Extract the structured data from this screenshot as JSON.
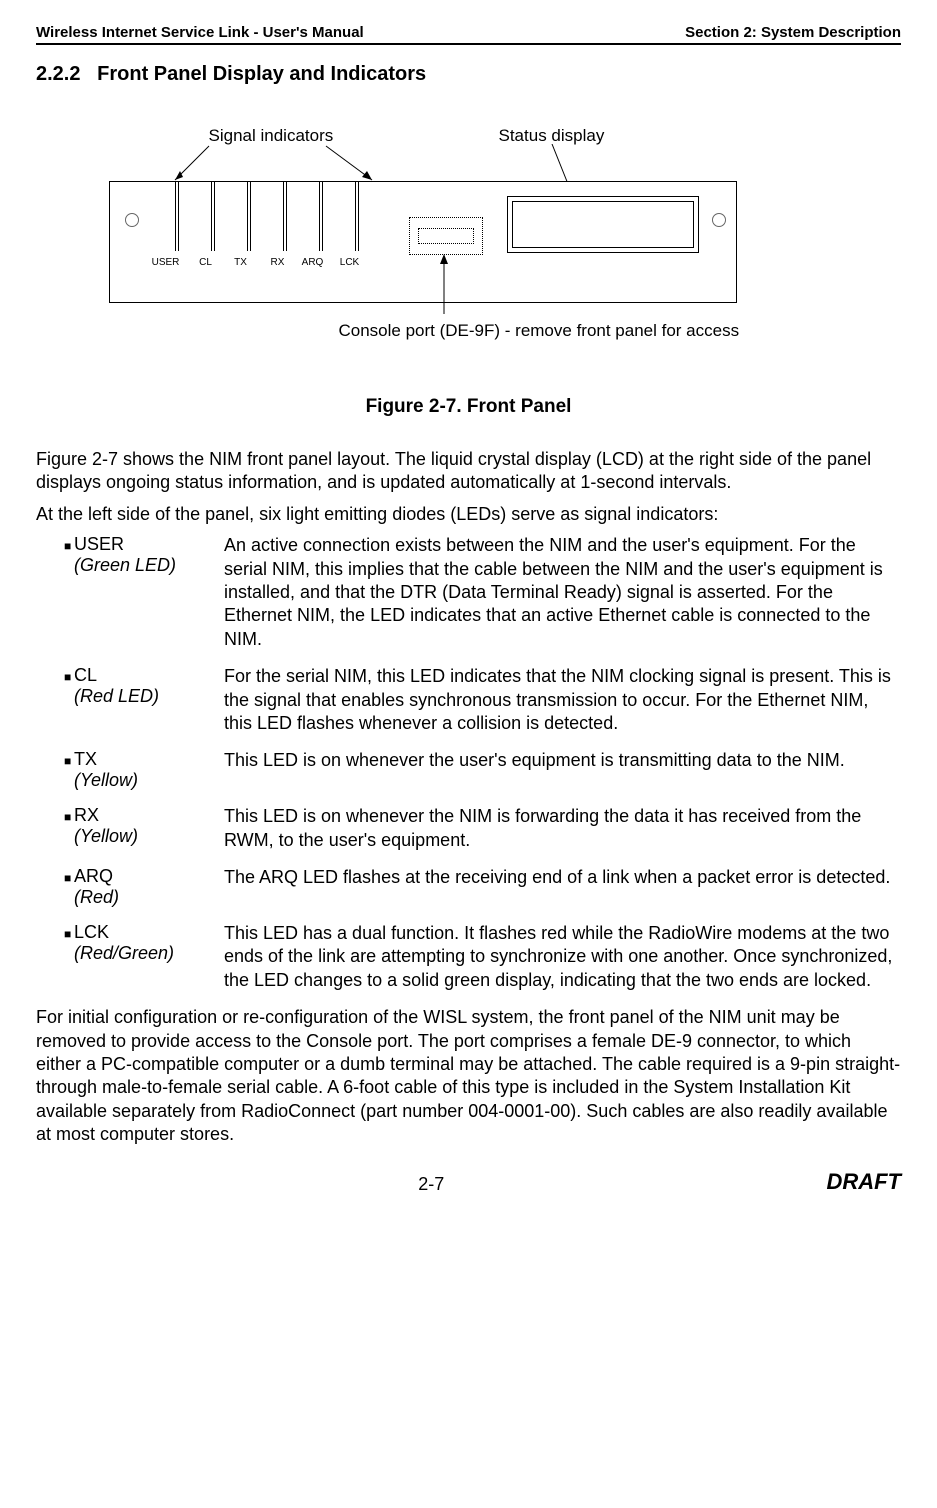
{
  "header": {
    "left": "Wireless Internet Service Link - User's Manual",
    "right": "Section 2: System Description"
  },
  "section_number": "2.2.2",
  "section_title": "Front Panel Display and Indicators",
  "figure": {
    "label_signal": "Signal indicators",
    "label_status": "Status display",
    "label_console": "Console port (DE-9F)  -  remove front panel for access",
    "leds": [
      "USER",
      "CL",
      "TX",
      "RX",
      "ARQ",
      "LCK"
    ],
    "caption": "Figure 2-7.  Front Panel"
  },
  "para1": "Figure 2-7 shows the NIM front panel layout.  The liquid crystal display (LCD) at the right side of the panel displays ongoing status information, and is updated automatically at 1-second intervals.",
  "para2": "At the left side of the panel, six light emitting diodes (LEDs) serve as signal indicators:",
  "leds": [
    {
      "name": "USER",
      "color": "(Green LED)",
      "desc": "An active connection exists between the NIM and the user's equipment.  For the serial NIM, this implies that the cable between the NIM and the user's equipment is installed, and that the DTR (Data Terminal Ready) signal is asserted.  For the Ethernet NIM, the LED indicates that an active Ethernet cable is connected to the NIM."
    },
    {
      "name": "CL",
      "color": "(Red LED)",
      "desc": "For the serial NIM, this LED indicates that the NIM clocking signal is present. This is the signal that enables synchronous transmission to occur.  For the Ethernet NIM, this LED flashes whenever a collision is detected."
    },
    {
      "name": "TX",
      "color": "(Yellow)",
      "desc": "This LED is on whenever the user's equipment is transmitting data to the NIM."
    },
    {
      "name": "RX",
      "color": "(Yellow)",
      "desc": "This LED is on whenever the NIM is forwarding the data it has received from the RWM, to the user's equipment."
    },
    {
      "name": "ARQ",
      "color": "(Red)",
      "desc": "The ARQ LED flashes at the receiving end of a link when a packet error is detected."
    },
    {
      "name": "LCK",
      "color": "(Red/Green)",
      "desc": "This LED has a dual function.  It flashes red while the RadioWire modems at the two ends of the link are attempting to synchronize with one another. Once synchronized, the LED changes to a solid green display, indicating that the two ends are locked."
    }
  ],
  "para3": "For initial configuration or re-configuration of the WISL system, the front panel of the NIM unit may be removed to provide access to the Console port.  The port comprises a female DE-9 connector, to which either a PC-compatible computer or a dumb terminal may be attached.  The cable required is a 9-pin straight-through male-to-female serial cable.  A 6-foot cable of this type is included in the System Installation Kit available separately from RadioConnect (part number 004-0001-00).  Such cables are also readily available at most computer stores.",
  "footer": {
    "page": "2-7",
    "draft": "DRAFT"
  }
}
